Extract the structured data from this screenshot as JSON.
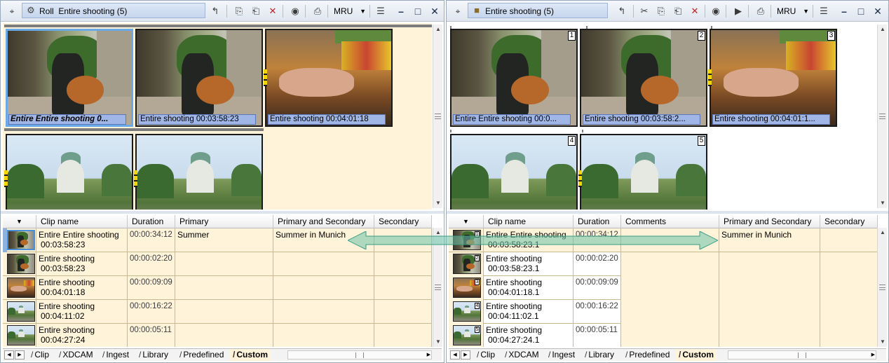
{
  "left": {
    "mode_label": "Roll",
    "title": "Entire shooting (5)",
    "mru_label": "MRU",
    "thumbnails": [
      {
        "caption": "Entire Entire shooting 0...",
        "selected": true
      },
      {
        "caption": "Entire shooting 00:03:58:23"
      },
      {
        "caption": "Entire shooting 00:04:01:18"
      },
      {
        "caption": ""
      },
      {
        "caption": ""
      }
    ],
    "columns": [
      "Clip name",
      "Duration",
      "Primary",
      "Primary and Secondary",
      "Secondary"
    ],
    "rows": [
      {
        "name1": "Entire Entire shooting",
        "name2": "00:03:58:23",
        "duration": "00:00:34:12",
        "primary": "Summer",
        "primary_secondary": "Summer in Munich",
        "secondary": ""
      },
      {
        "name1": "Entire shooting",
        "name2": "00:03:58:23",
        "duration": "00:00:02:20",
        "primary": "",
        "primary_secondary": "",
        "secondary": ""
      },
      {
        "name1": "Entire shooting",
        "name2": "00:04:01:18",
        "duration": "00:00:09:09",
        "primary": "",
        "primary_secondary": "",
        "secondary": ""
      },
      {
        "name1": "Entire shooting",
        "name2": "00:04:11:02",
        "duration": "00:00:16:22",
        "primary": "",
        "primary_secondary": "",
        "secondary": ""
      },
      {
        "name1": "Entire shooting",
        "name2": "00:04:27:24",
        "duration": "00:00:05:11",
        "primary": "",
        "primary_secondary": "",
        "secondary": ""
      }
    ],
    "tabs": [
      "Clip",
      "XDCAM",
      "Ingest",
      "Library",
      "Predefined",
      "Custom"
    ],
    "active_tab": "Custom"
  },
  "right": {
    "title": "Entire shooting (5)",
    "mru_label": "MRU",
    "thumbnails": [
      {
        "caption": "Entire Entire shooting 00:0...",
        "num": "1"
      },
      {
        "caption": "Entire shooting 00:03:58:2...",
        "num": "2"
      },
      {
        "caption": "Entire shooting 00:04:01:1...",
        "num": "3"
      },
      {
        "caption": "",
        "num": "4"
      },
      {
        "caption": "",
        "num": "5"
      }
    ],
    "columns": [
      "Clip name",
      "Duration",
      "Comments",
      "Primary and Secondary",
      "Secondary"
    ],
    "rows": [
      {
        "num": "1",
        "name1": "Entire Entire shooting",
        "name2": "00:03:58:23.1",
        "duration": "00:00:34:12",
        "comments": "",
        "primary_secondary": "Summer in Munich",
        "secondary": ""
      },
      {
        "num": "2",
        "name1": "Entire shooting",
        "name2": "00:03:58:23.1",
        "duration": "00:00:02:20",
        "comments": "",
        "primary_secondary": "",
        "secondary": ""
      },
      {
        "num": "3",
        "name1": "Entire shooting",
        "name2": "00:04:01:18.1",
        "duration": "00:00:09:09",
        "comments": "",
        "primary_secondary": "",
        "secondary": ""
      },
      {
        "num": "4",
        "name1": "Entire shooting",
        "name2": "00:04:11:02.1",
        "duration": "00:00:16:22",
        "comments": "",
        "primary_secondary": "",
        "secondary": ""
      },
      {
        "num": "5",
        "name1": "Entire shooting",
        "name2": "00:04:27:24.1",
        "duration": "00:00:05:11",
        "comments": "",
        "primary_secondary": "",
        "secondary": ""
      }
    ],
    "tabs": [
      "Clip",
      "XDCAM",
      "Ingest",
      "Library",
      "Predefined",
      "Custom"
    ],
    "active_tab": "Custom"
  },
  "colors": {
    "row_beige": "#fff3d9",
    "caption_blue": "#9fb6e6",
    "link_arrow": "#6cc3aa"
  }
}
